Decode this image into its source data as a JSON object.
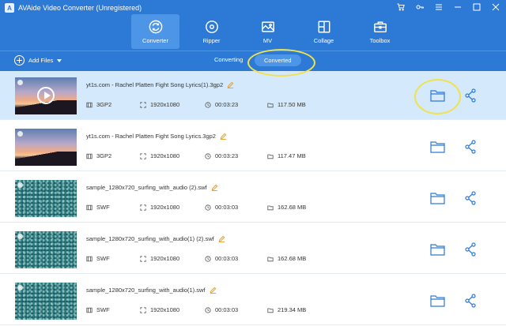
{
  "app": {
    "title": "AVAide Video Converter (Unregistered)",
    "logo_letter": "A"
  },
  "nav": {
    "tabs": [
      {
        "label": "Converter",
        "icon": "converter-icon",
        "active": true
      },
      {
        "label": "Ripper",
        "icon": "disc-icon"
      },
      {
        "label": "MV",
        "icon": "mv-image-icon"
      },
      {
        "label": "Collage",
        "icon": "collage-icon"
      },
      {
        "label": "Toolbox",
        "icon": "toolbox-icon"
      }
    ]
  },
  "toolbar": {
    "add_files_label": "Add Files",
    "segments": {
      "converting": "Converting",
      "converted": "Converted"
    },
    "active_segment": "converted"
  },
  "files": [
    {
      "name": "yt1s.com - Rachel Platten  Fight Song Lyrics(1).3gp2",
      "format": "3GP2",
      "resolution": "1920x1080",
      "duration": "00:03:23",
      "size": "117.50 MB",
      "thumb": "sunset",
      "playing": true,
      "selected": true
    },
    {
      "name": "yt1s.com - Rachel Platten  Fight Song Lyrics.3gp2",
      "format": "3GP2",
      "resolution": "1920x1080",
      "duration": "00:03:23",
      "size": "117.47 MB",
      "thumb": "sunset"
    },
    {
      "name": "sample_1280x720_surfing_with_audio (2).swf",
      "format": "SWF",
      "resolution": "1920x1080",
      "duration": "00:03:03",
      "size": "162.68 MB",
      "thumb": "water"
    },
    {
      "name": "sample_1280x720_surfing_with_audio(1) (2).swf",
      "format": "SWF",
      "resolution": "1920x1080",
      "duration": "00:03:03",
      "size": "162.68 MB",
      "thumb": "water"
    },
    {
      "name": "sample_1280x720_surfing_with_audio(1).swf",
      "format": "SWF",
      "resolution": "1920x1080",
      "duration": "00:03:03",
      "size": "219.34 MB",
      "thumb": "water"
    }
  ],
  "colors": {
    "brand_blue": "#2c7ad6",
    "selected_row": "#d4e9fb",
    "highlight_ring": "#f0e24a",
    "edit_icon": "#f0a020"
  }
}
